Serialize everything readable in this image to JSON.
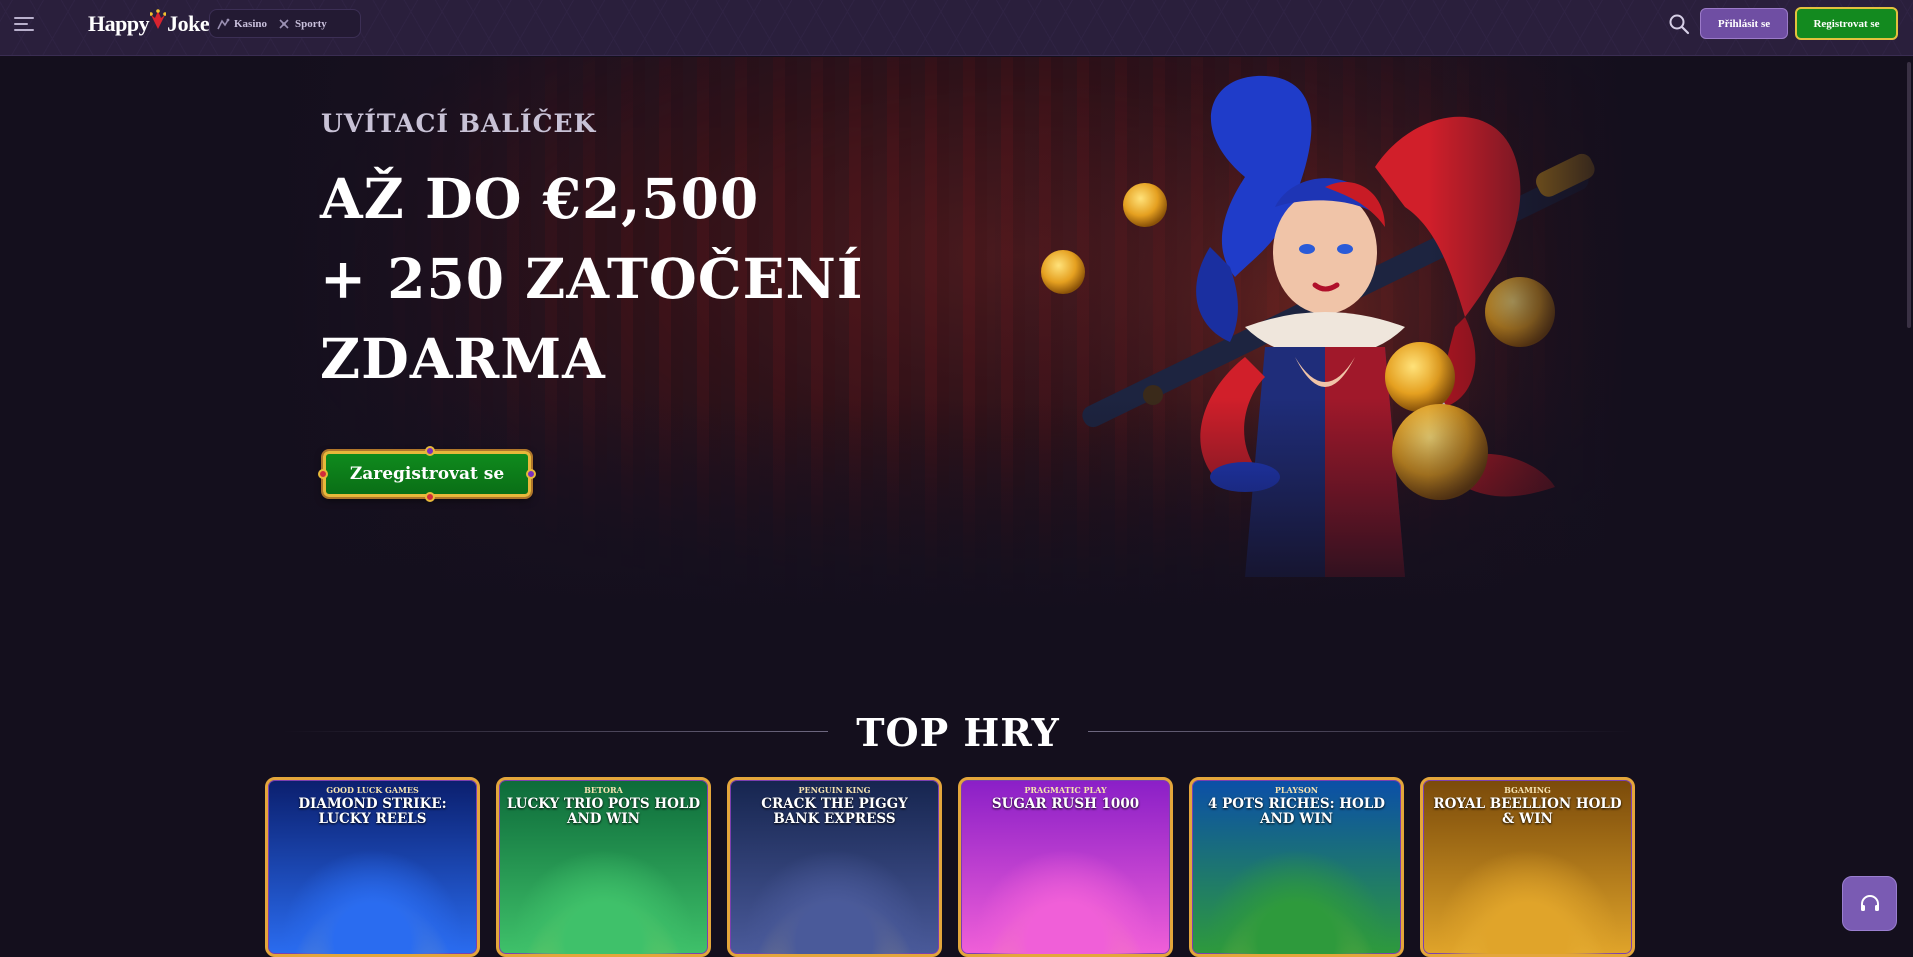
{
  "header": {
    "logo_text": "HAPPYJOKERS",
    "logo_part1": "Happy",
    "logo_part2": "Jokers",
    "nav": [
      {
        "label": "Kasino",
        "icon": "casino-icon"
      },
      {
        "label": "Sporty",
        "icon": "sports-icon"
      }
    ],
    "login_label": "Přihlásit se",
    "register_label": "Registrovat se"
  },
  "hero": {
    "subtitle": "UVÍTACÍ BALÍČEK",
    "title_lines": [
      "AŽ DO €2,500",
      "+ 250 ZATOČENÍ",
      "ZDARMA"
    ],
    "cta_label": "Zaregistrovat se"
  },
  "top_games": {
    "title": "TOP HRY",
    "games": [
      {
        "provider": "Good Luck Games",
        "name": "Diamond Strike: Lucky Reels",
        "colors": [
          "#0b1f6e",
          "#2a6cf0"
        ]
      },
      {
        "provider": "Betora",
        "name": "Lucky Trio Pots Hold and Win",
        "colors": [
          "#0d6b3a",
          "#3fc16a"
        ]
      },
      {
        "provider": "Penguin King",
        "name": "Crack The Piggy Bank Express",
        "colors": [
          "#16254f",
          "#4a5a9a"
        ]
      },
      {
        "provider": "Pragmatic Play",
        "name": "Sugar Rush 1000",
        "colors": [
          "#8a1fc7",
          "#f05fd8"
        ]
      },
      {
        "provider": "Playson",
        "name": "4 Pots Riches: Hold and Win",
        "colors": [
          "#0b4fa8",
          "#2e9a3c"
        ]
      },
      {
        "provider": "BGaming",
        "name": "Royal Beellion Hold & Win",
        "colors": [
          "#7a4a0a",
          "#e0a42a"
        ]
      }
    ]
  },
  "icons": {
    "menu": "menu-icon",
    "search": "search-icon",
    "support": "headset-icon"
  },
  "colors": {
    "background": "#140f1d",
    "header": "#2a1f3c",
    "login": "#6f4ea3",
    "register": "#138a1f",
    "gold": "#e4a63b"
  }
}
